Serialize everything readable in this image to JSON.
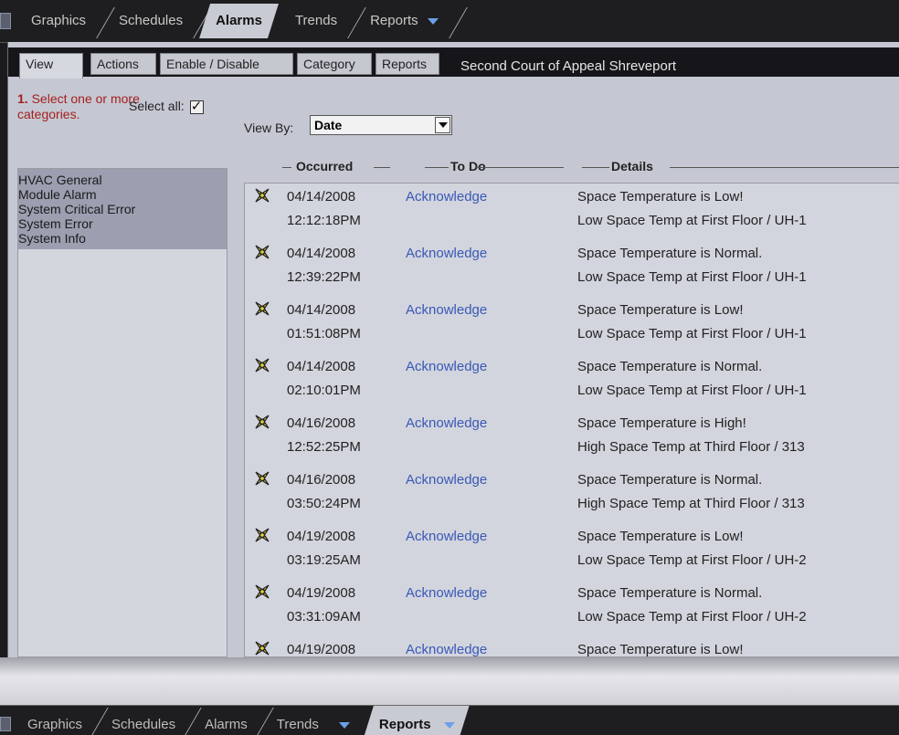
{
  "nav": {
    "tabs": [
      {
        "label": "Graphics"
      },
      {
        "label": "Schedules"
      },
      {
        "label": "Alarms"
      },
      {
        "label": "Trends"
      },
      {
        "label": "Reports"
      }
    ],
    "active": "Alarms"
  },
  "subnav": {
    "tabs": [
      {
        "label": "View"
      },
      {
        "label": "Actions"
      },
      {
        "label": "Enable / Disable"
      },
      {
        "label": "Category"
      },
      {
        "label": "Reports"
      }
    ],
    "site_title": "Second Court of Appeal Shreveport"
  },
  "left": {
    "instruction_num": "1.",
    "instruction": "Select one or more categories.",
    "select_all_label": "Select all:",
    "select_all_checked": true,
    "categories": [
      "HVAC General",
      "Module Alarm",
      "System Critical Error",
      "System Error",
      "System Info"
    ]
  },
  "viewby": {
    "label": "View By:",
    "value": "Date"
  },
  "columns": {
    "occurred": "Occurred",
    "todo": "To Do",
    "details": "Details"
  },
  "alarms": [
    {
      "date": "04/14/2008",
      "time": "12:12:18PM",
      "action": "Acknowledge",
      "msg": "Space Temperature is Low!",
      "detail": "Low Space Temp at First Floor / UH-1"
    },
    {
      "date": "04/14/2008",
      "time": "12:39:22PM",
      "action": "Acknowledge",
      "msg": "Space Temperature is Normal.",
      "detail": "Low Space Temp at First Floor / UH-1"
    },
    {
      "date": "04/14/2008",
      "time": "01:51:08PM",
      "action": "Acknowledge",
      "msg": "Space Temperature is Low!",
      "detail": "Low Space Temp at First Floor / UH-1"
    },
    {
      "date": "04/14/2008",
      "time": "02:10:01PM",
      "action": "Acknowledge",
      "msg": "Space Temperature is Normal.",
      "detail": "Low Space Temp at First Floor / UH-1"
    },
    {
      "date": "04/16/2008",
      "time": "12:52:25PM",
      "action": "Acknowledge",
      "msg": "Space Temperature is High!",
      "detail": "High Space Temp at Third Floor / 313"
    },
    {
      "date": "04/16/2008",
      "time": "03:50:24PM",
      "action": "Acknowledge",
      "msg": "Space Temperature is Normal.",
      "detail": "High Space Temp at Third Floor / 313"
    },
    {
      "date": "04/19/2008",
      "time": "03:19:25AM",
      "action": "Acknowledge",
      "msg": "Space Temperature is Low!",
      "detail": "Low Space Temp at First Floor / UH-2"
    },
    {
      "date": "04/19/2008",
      "time": "03:31:09AM",
      "action": "Acknowledge",
      "msg": "Space Temperature is Normal.",
      "detail": "Low Space Temp at First Floor / UH-2"
    },
    {
      "date": "04/19/2008",
      "time": "",
      "action": "Acknowledge",
      "msg": "Space Temperature is Low!",
      "detail": ""
    }
  ],
  "bottom_nav": {
    "tabs": [
      {
        "label": "Graphics"
      },
      {
        "label": "Schedules"
      },
      {
        "label": "Alarms"
      },
      {
        "label": "Trends"
      },
      {
        "label": "Reports"
      }
    ],
    "active": "Reports"
  },
  "colors": {
    "link": "#3a58b8",
    "instruction": "#a32020",
    "alarm_icon": "#e8d23a"
  }
}
